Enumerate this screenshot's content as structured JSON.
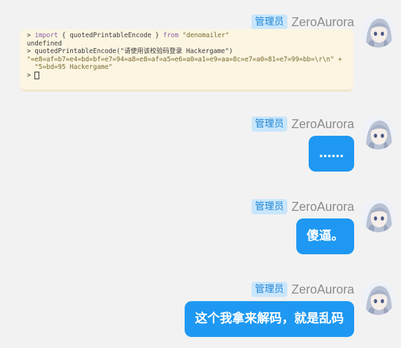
{
  "messages": [
    {
      "badge": "管理员",
      "name": "ZeroAurora",
      "type": "screenshot",
      "console_lines": [
        {
          "prompt": ">",
          "kw1": "import",
          "mid": " { quotedPrintableEncode } ",
          "kw2": "from",
          "str": " \"denomailer\""
        },
        {
          "plain": "undefined"
        },
        {
          "prompt": ">",
          "plain": " quotedPrintableEncode(\"请使用该校验码登录 Hackergame\")"
        },
        {
          "plain": "\"=e8=af=b7=e4=bd=bf=e7=94=a8=e8=af=a5=e6=a0=a1=e9=aa=8c=e7=a0=81=e7=99=bb=\\r\\n\" +"
        },
        {
          "plain": "  \"5=bd=95 Hackergame\""
        },
        {
          "prompt": ">"
        }
      ]
    },
    {
      "badge": "管理员",
      "name": "ZeroAurora",
      "type": "text",
      "text": "……"
    },
    {
      "badge": "管理员",
      "name": "ZeroAurora",
      "type": "text",
      "text": "傻逼。"
    },
    {
      "badge": "管理员",
      "name": "ZeroAurora",
      "type": "text",
      "text": "这个我拿来解码，就是乱码"
    }
  ],
  "colors": {
    "bubble": "#1e98f2",
    "badge_bg": "#c9e6fb",
    "badge_text": "#1f86d6",
    "background": "#f2f2f2"
  },
  "icons": {
    "avatar": "anime-avatar-icon"
  }
}
